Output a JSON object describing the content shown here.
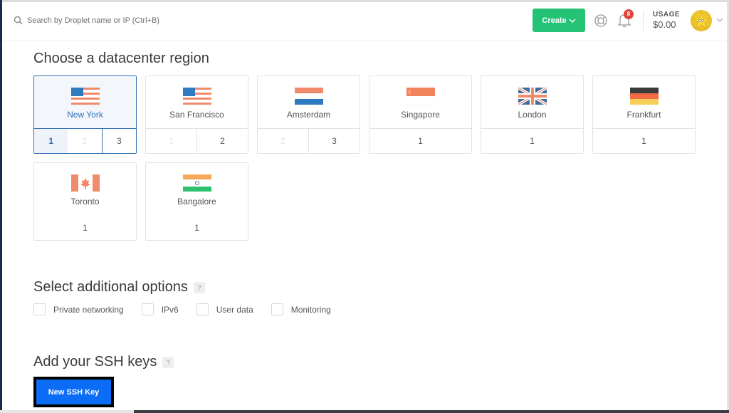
{
  "header": {
    "search_placeholder": "Search by Droplet name or IP (Ctrl+B)",
    "create_label": "Create",
    "notification_count": "8",
    "usage_label": "USAGE",
    "usage_value": "$0.00"
  },
  "datacenter": {
    "title": "Choose a datacenter region",
    "regions": [
      {
        "city": "New York",
        "flag": "us-flag",
        "selected": true,
        "numbers": [
          "1",
          "2",
          "3"
        ]
      },
      {
        "city": "San Francisco",
        "flag": "us-flag",
        "selected": false,
        "numbers": [
          "1",
          "2"
        ]
      },
      {
        "city": "Amsterdam",
        "flag": "nl-flag",
        "selected": false,
        "numbers": [
          "2",
          "3"
        ]
      },
      {
        "city": "Singapore",
        "flag": "sg-flag",
        "selected": false,
        "numbers": [
          "1"
        ]
      },
      {
        "city": "London",
        "flag": "uk-flag",
        "selected": false,
        "numbers": [
          "1"
        ]
      },
      {
        "city": "Frankfurt",
        "flag": "de-flag",
        "selected": false,
        "numbers": [
          "1"
        ]
      },
      {
        "city": "Toronto",
        "flag": "ca-flag",
        "selected": false,
        "numbers": [
          "1"
        ]
      },
      {
        "city": "Bangalore",
        "flag": "in-flag",
        "selected": false,
        "numbers": [
          "1"
        ]
      }
    ]
  },
  "options": {
    "title": "Select additional options",
    "help": "?",
    "items": [
      {
        "label": "Private networking",
        "checked": false
      },
      {
        "label": "IPv6",
        "checked": false
      },
      {
        "label": "User data",
        "checked": false
      },
      {
        "label": "Monitoring",
        "checked": false
      }
    ]
  },
  "ssh": {
    "title": "Add your SSH keys",
    "help": "?",
    "new_key_label": "New SSH Key"
  },
  "colors": {
    "create_green": "#23c275",
    "selected_blue": "#2f6fb5",
    "ssh_button_blue": "#0b6cf5",
    "badge_red": "#e0453a"
  }
}
